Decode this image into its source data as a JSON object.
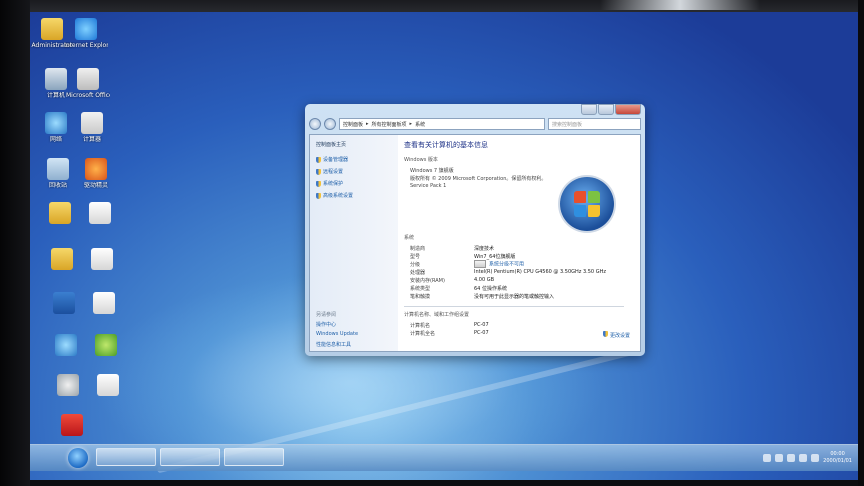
{
  "desktop_icons": [
    {
      "label": "Administrator",
      "icon": "folder-icon"
    },
    {
      "label": "Internet Explorer",
      "icon": "ie-icon"
    },
    {
      "label": "计算机",
      "icon": "computer-icon"
    },
    {
      "label": "Microsoft Office Wo...",
      "icon": "word-icon"
    },
    {
      "label": "网络",
      "icon": "network-icon"
    },
    {
      "label": "计算器",
      "icon": "document-icon"
    },
    {
      "label": "回收站",
      "icon": "recycle-bin-icon"
    },
    {
      "label": "驱动精灵",
      "icon": "driver-icon"
    },
    {
      "label": "",
      "icon": "folder-icon"
    },
    {
      "label": "",
      "icon": "page-icon"
    },
    {
      "label": "",
      "icon": "folder-icon"
    },
    {
      "label": "",
      "icon": "page-icon"
    },
    {
      "label": "",
      "icon": "app-icon"
    },
    {
      "label": "",
      "icon": "page-icon"
    },
    {
      "label": "",
      "icon": "network-icon"
    },
    {
      "label": "",
      "icon": "green-app-icon"
    },
    {
      "label": "",
      "icon": "disk-icon"
    },
    {
      "label": "",
      "icon": "page-icon"
    },
    {
      "label": "",
      "icon": "red-app-icon"
    }
  ],
  "window": {
    "address_path": [
      "控制面板",
      "所有控制面板项",
      "系统"
    ],
    "search_placeholder": "搜索控制面板",
    "sidebar": {
      "home": "控制面板主页",
      "links": [
        "设备管理器",
        "远程设置",
        "系统保护",
        "高级系统设置"
      ],
      "see_also_title": "另请参阅",
      "see_also": [
        "操作中心",
        "Windows Update",
        "性能信息和工具"
      ]
    },
    "heading": "查看有关计算机的基本信息",
    "edition_section": "Windows 版本",
    "edition": "Windows 7 旗舰版",
    "copyright": "版权所有 © 2009 Microsoft Corporation。保留所有权利。",
    "service_pack": "Service Pack 1",
    "system_section": "系统",
    "system_rows": [
      {
        "k": "制造商",
        "v": "深度技术"
      },
      {
        "k": "型号",
        "v": "Win7_64位旗舰版"
      },
      {
        "k": "分级",
        "v": "系统分级不可用"
      },
      {
        "k": "处理器",
        "v": "Intel(R) Pentium(R) CPU G4560 @ 3.50GHz   3.50 GHz"
      },
      {
        "k": "安装内存(RAM)",
        "v": "4.00 GB"
      },
      {
        "k": "系统类型",
        "v": "64 位操作系统"
      },
      {
        "k": "笔和触摸",
        "v": "没有可用于此显示器的笔或触控输入"
      }
    ],
    "computer_section": "计算机名称、域和工作组设置",
    "computer_rows": [
      {
        "k": "计算机名",
        "v": "PC-07"
      },
      {
        "k": "计算机全名",
        "v": "PC-07"
      }
    ],
    "change_settings": "更改设置"
  },
  "taskbar": {
    "buttons": [
      "",
      "",
      ""
    ],
    "tray": {
      "time": "00:00",
      "date": "2000/01/01"
    }
  }
}
